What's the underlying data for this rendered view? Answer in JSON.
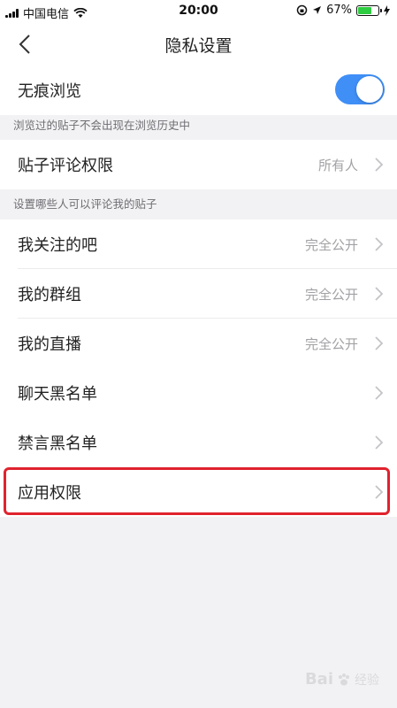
{
  "status_bar": {
    "carrier": "中国电信",
    "time": "20:00",
    "battery_percent": "67%",
    "battery_level": 0.67,
    "icons": [
      "signal-icon",
      "wifi-icon",
      "lock-rotation-icon",
      "location-icon",
      "battery-icon",
      "charging-icon"
    ]
  },
  "nav": {
    "title": "隐私设置",
    "back_icon": "chevron-left-icon"
  },
  "settings": {
    "incognito": {
      "label": "无痕浏览",
      "enabled": true,
      "note": "浏览过的贴子不会出现在浏览历史中"
    },
    "post_comment": {
      "label": "贴子评论权限",
      "value": "所有人",
      "note": "设置哪些人可以评论我的贴子"
    },
    "followed_bars": {
      "label": "我关注的吧",
      "value": "完全公开"
    },
    "my_groups": {
      "label": "我的群组",
      "value": "完全公开"
    },
    "my_live": {
      "label": "我的直播",
      "value": "完全公开"
    },
    "chat_blacklist": {
      "label": "聊天黑名单"
    },
    "mute_blacklist": {
      "label": "禁言黑名单"
    },
    "app_permissions": {
      "label": "应用权限"
    }
  },
  "colors": {
    "accent": "#3f8ff7",
    "highlight": "#e0232e",
    "background": "#f2f2f4"
  },
  "watermark": {
    "text": "Bai",
    "sub": "经验"
  }
}
